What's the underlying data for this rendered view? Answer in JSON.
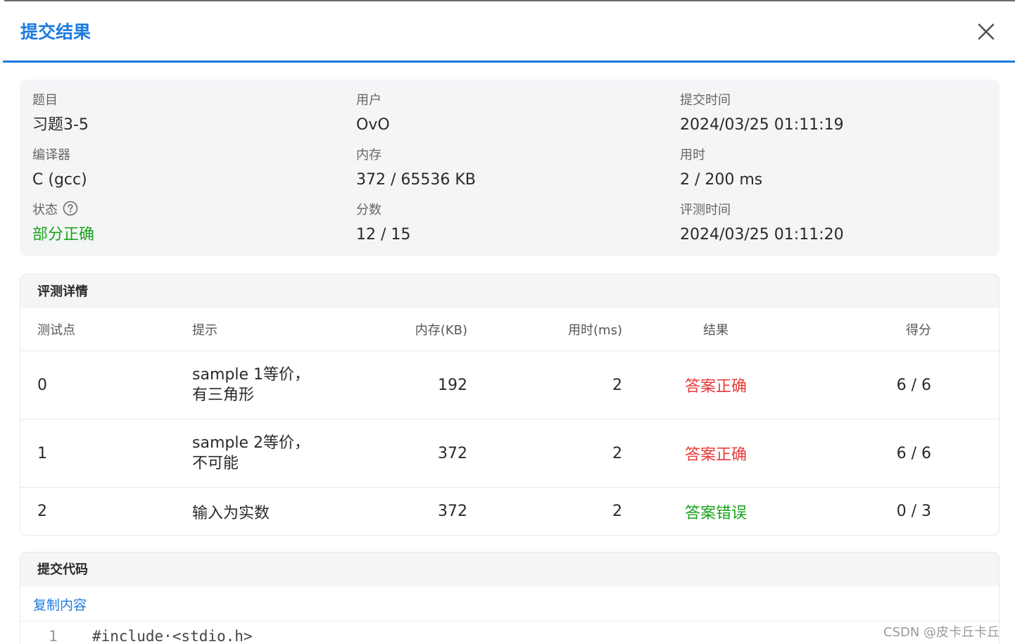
{
  "dialog": {
    "title": "提交结果",
    "close_icon": "close-icon"
  },
  "info": {
    "problem_label": "题目",
    "problem_value": "习题3-5",
    "user_label": "用户",
    "user_value": "OvO",
    "submit_time_label": "提交时间",
    "submit_time_value": "2024/03/25 01:11:19",
    "compiler_label": "编译器",
    "compiler_value": "C (gcc)",
    "memory_label": "内存",
    "memory_value": "372 / 65536 KB",
    "time_label": "用时",
    "time_value": "2 / 200 ms",
    "status_label": "状态",
    "status_value": "部分正确",
    "status_help_icon": "question-circle-icon",
    "score_label": "分数",
    "score_value": "12 / 15",
    "judge_time_label": "评测时间",
    "judge_time_value": "2024/03/25 01:11:20",
    "status_color": "#1aa31a"
  },
  "details": {
    "title": "评测详情",
    "headers": {
      "case": "测试点",
      "hint": "提示",
      "memory": "内存(KB)",
      "time": "用时(ms)",
      "result": "结果",
      "score": "得分"
    },
    "rows": [
      {
        "case": "0",
        "hint_line1": "sample 1等价，",
        "hint_line2": "有三角形",
        "memory": "192",
        "time": "2",
        "result": "答案正确",
        "score": "6 / 6"
      },
      {
        "case": "1",
        "hint_line1": "sample 2等价，",
        "hint_line2": "不可能",
        "memory": "372",
        "time": "2",
        "result": "答案正确",
        "score": "6 / 6"
      },
      {
        "case": "2",
        "hint_line1": "输入为实数",
        "hint_line2": "",
        "memory": "372",
        "time": "2",
        "result": "答案错误",
        "score": "0 / 3"
      }
    ],
    "colors": {
      "correct": "#e83a3a",
      "wrong": "#1aa31a"
    }
  },
  "code": {
    "title": "提交代码",
    "copy_label": "复制内容",
    "lines": [
      {
        "no": "1",
        "text": "#include·<stdio.h>"
      }
    ]
  },
  "watermark": "CSDN @皮卡丘卡丘",
  "accent_color": "#1c7be0"
}
